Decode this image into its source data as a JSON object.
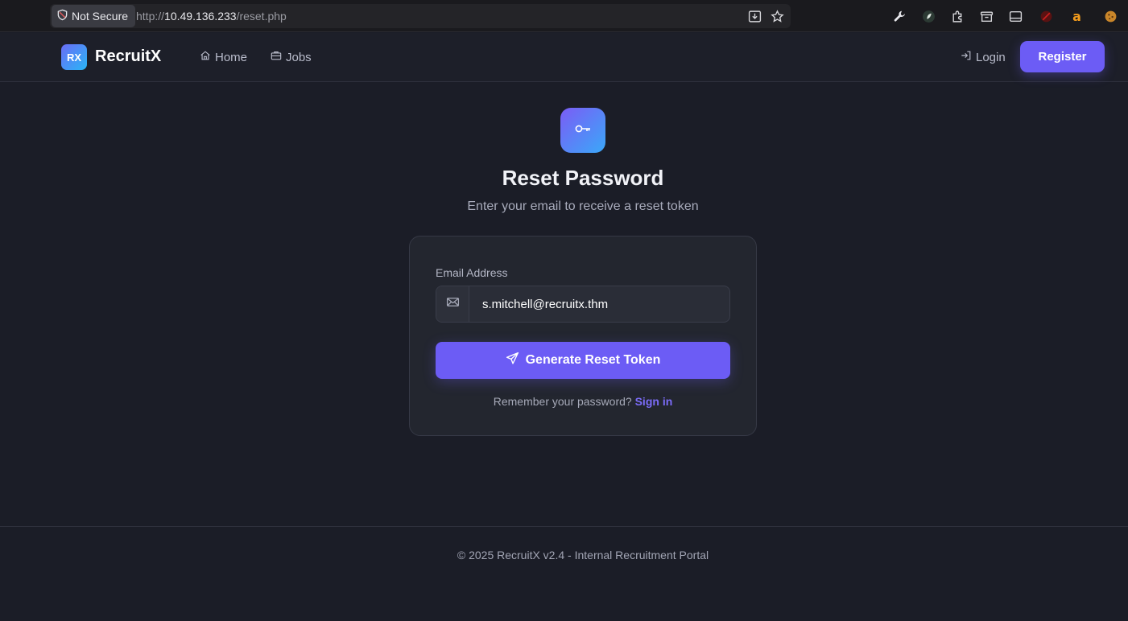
{
  "browser": {
    "security_label": "Not Secure",
    "url_scheme": "http://",
    "url_host": "10.49.136.233",
    "url_path": "/reset.php"
  },
  "nav": {
    "logo_text": "RX",
    "brand": "RecruitX",
    "home_label": "Home",
    "jobs_label": "Jobs",
    "login_label": "Login",
    "register_label": "Register"
  },
  "main": {
    "title": "Reset Password",
    "subtitle": "Enter your email to receive a reset token",
    "email_label": "Email Address",
    "email_value": "s.mitchell@recruitx.thm",
    "submit_label": "Generate Reset Token",
    "remember_text": "Remember your password?",
    "signin_label": "Sign in"
  },
  "footer": {
    "text": "© 2025 RecruitX v2.4 - Internal Recruitment Portal"
  },
  "colors": {
    "accent": "#6c5cf5",
    "background": "#1b1d27",
    "card": "#23262f"
  }
}
